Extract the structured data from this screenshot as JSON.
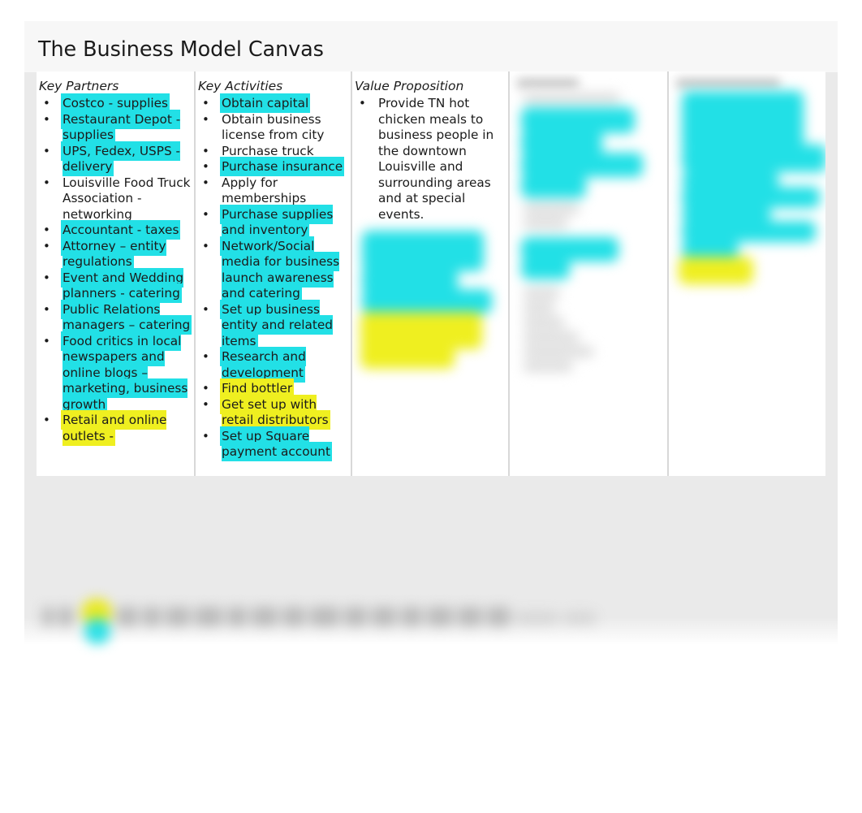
{
  "slide": {
    "title": "The Business Model Canvas"
  },
  "canvas": {
    "columns": [
      {
        "header": "Key Partners",
        "legible": true,
        "items": [
          {
            "text": "Costco - supplies",
            "highlight": "cyan"
          },
          {
            "text": "Restaurant Depot - supplies",
            "highlight": "cyan"
          },
          {
            "text": "UPS, Fedex, USPS - delivery",
            "highlight": "cyan"
          },
          {
            "text": "Louisville Food Truck Association - networking",
            "highlight": "none"
          },
          {
            "text": "Accountant - taxes",
            "highlight": "cyan"
          },
          {
            "text": "Attorney – entity regulations",
            "highlight": "cyan"
          },
          {
            "text": "Event and Wedding planners - catering",
            "highlight": "cyan"
          },
          {
            "text": "Public Relations managers – catering",
            "highlight": "cyan"
          },
          {
            "text": "Food critics in local newspapers and online blogs – marketing, business growth",
            "highlight": "cyan"
          },
          {
            "text": "Retail and online outlets -",
            "highlight": "yellow"
          }
        ]
      },
      {
        "header": "Key Activities",
        "legible": true,
        "items": [
          {
            "text": "Obtain capital",
            "highlight": "cyan"
          },
          {
            "text": "Obtain business license from city",
            "highlight": "none"
          },
          {
            "text": "Purchase truck",
            "highlight": "none"
          },
          {
            "text": "Purchase insurance",
            "highlight": "cyan"
          },
          {
            "text": "Apply for memberships",
            "highlight": "none"
          },
          {
            "text": "Purchase supplies and inventory",
            "highlight": "cyan"
          },
          {
            "text": "Network/Social media for business launch awareness and catering",
            "highlight": "cyan"
          },
          {
            "text": "Set up business entity and related items",
            "highlight": "cyan"
          },
          {
            "text": "Research and development",
            "highlight": "cyan"
          },
          {
            "text": "Find bottler",
            "highlight": "yellow"
          },
          {
            "text": "Get set up with retail distributors",
            "highlight": "yellow"
          },
          {
            "text": "Set up Square payment account",
            "highlight": "cyan"
          }
        ]
      },
      {
        "header": "Value Proposition",
        "legible": true,
        "items": [
          {
            "text": "Provide TN hot chicken meals to business people in the downtown Louisville and surrounding areas and at special events.",
            "highlight": "none"
          }
        ],
        "redacted_below": true
      },
      {
        "header": "",
        "legible": false,
        "items": [],
        "redacted_below": true
      },
      {
        "header": "",
        "legible": false,
        "items": [],
        "redacted_below": true
      }
    ]
  },
  "colors": {
    "highlight_cyan": "#22e0e6",
    "highlight_yellow": "#efef20",
    "slide_background": "#eaeaea",
    "cell_background": "#ffffff",
    "text": "#1b1b1b",
    "divider": "#d8d8d8"
  }
}
